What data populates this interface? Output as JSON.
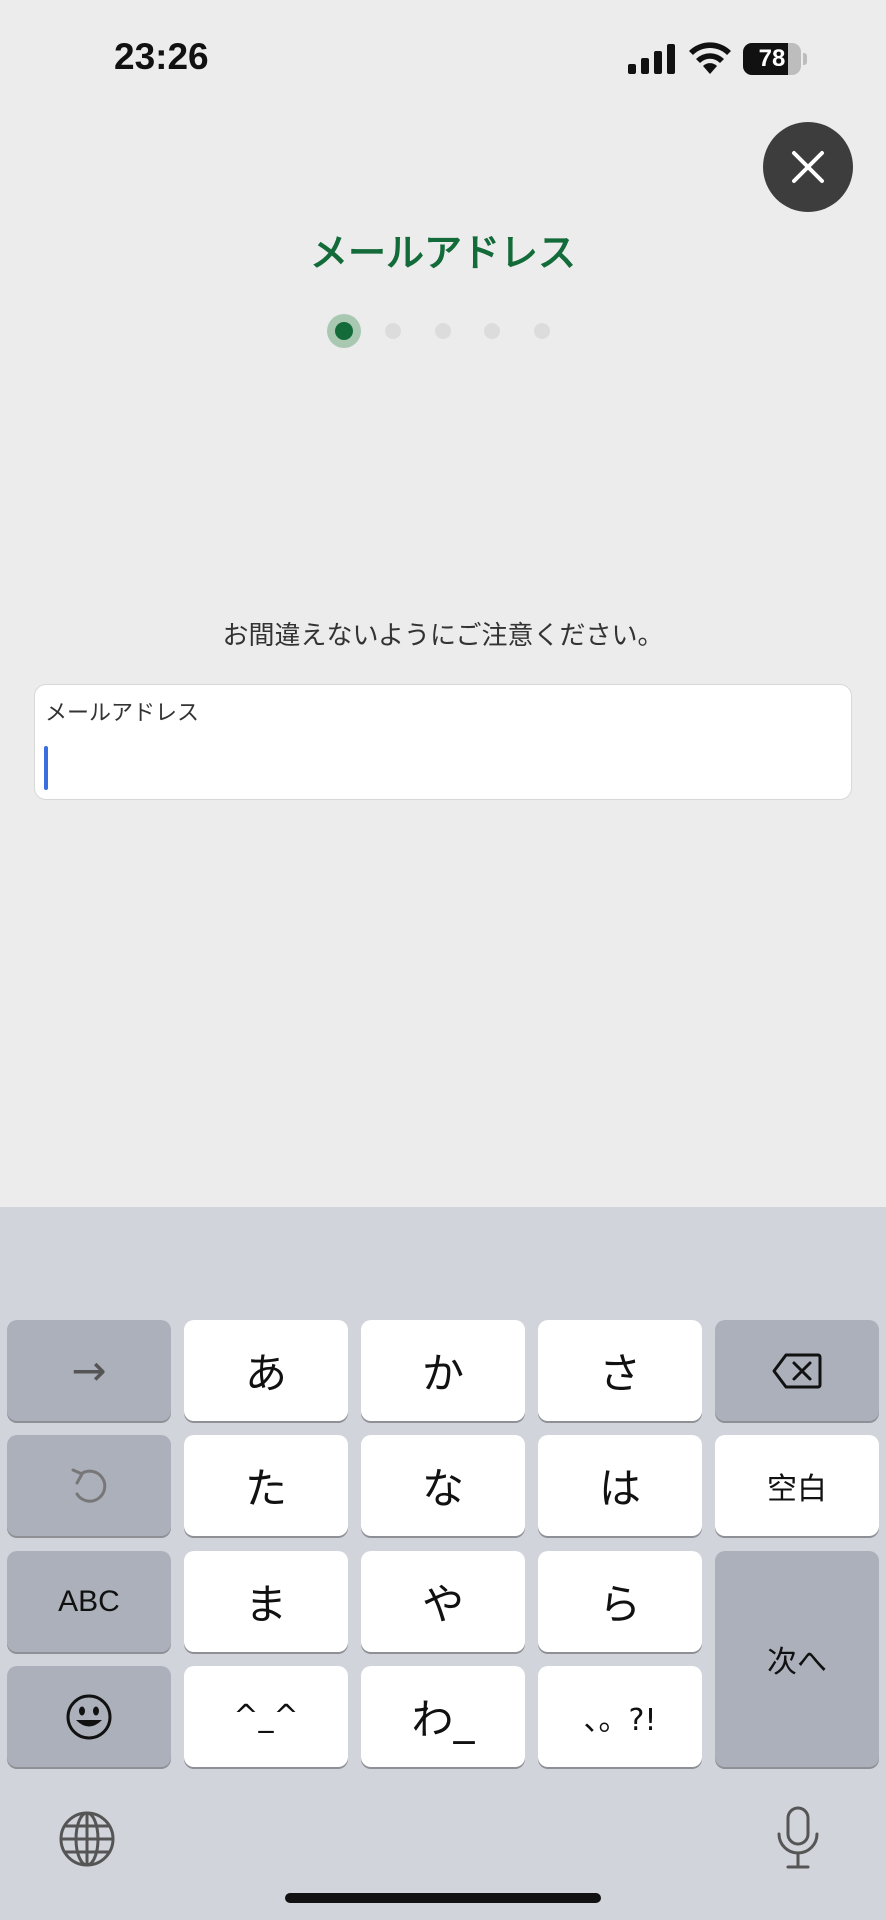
{
  "status": {
    "time": "23:26",
    "battery": "78",
    "battery_level": 0.78
  },
  "header": {
    "title": "メールアドレス",
    "steps_total": 5,
    "current_step": 1
  },
  "main": {
    "instruction": "お間違えないようにご注意ください。",
    "email": {
      "label": "メールアドレス",
      "value": ""
    }
  },
  "keyboard": {
    "keys": {
      "arrow": "→",
      "a": "あ",
      "ka": "か",
      "sa": "さ",
      "ta": "た",
      "na": "な",
      "ha": "は",
      "space": "空白",
      "abc": "ABC",
      "ma": "ま",
      "ya": "や",
      "ra": "ら",
      "next": "次へ",
      "kaomoji": "^_^",
      "wa": "わ_",
      "punct": "、。?!"
    }
  },
  "colors": {
    "accent": "#146b3a",
    "caret": "#3b6fe0",
    "background": "#ececec",
    "keyboard_bg": "#d1d4db"
  }
}
